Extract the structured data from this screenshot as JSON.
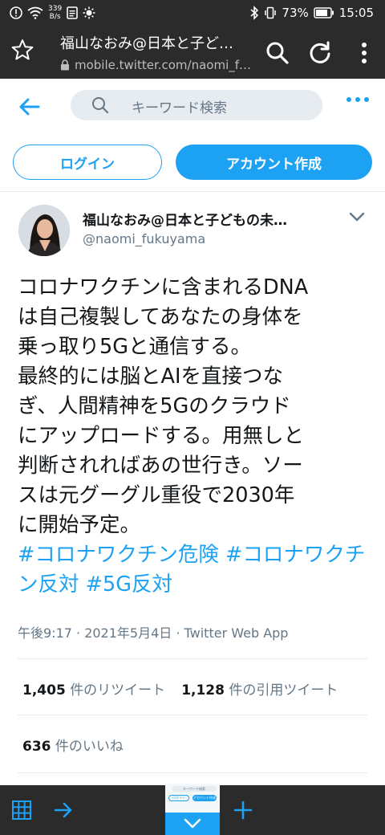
{
  "status_bar": {
    "net_speed_top": "339",
    "net_speed_bottom": "B/s",
    "battery": "73%",
    "time": "15:05"
  },
  "browser": {
    "title": "福山なおみ@日本と子ど…",
    "url": "mobile.twitter.com/naomi_f…"
  },
  "twitter": {
    "search_placeholder": "キーワード検索",
    "login_label": "ログイン",
    "signup_label": "アカウント作成"
  },
  "tweet": {
    "author_name": "福山なおみ@日本と子どもの未…",
    "author_handle": "@naomi_fukuyama",
    "text": "コロナワクチンに含まれるDNA\nは自己複製してあなたの身体を\n乗っ取り5Gと通信する。\n最終的には脳とAIを直接つな\nぎ、人間精神を5Gのクラウド\nにアップロードする。用無しと\n判断されればあの世行き。ソー\nスは元グーグル重役で2030年\nに開始予定。",
    "hashtags": "#コロナワクチン危険 #コロナワクチン反対 #5G反対",
    "meta": "午後9:17 · 2021年5月4日 · Twitter Web App",
    "retweets_count": "1,405",
    "retweets_label": "件のリツイート",
    "quotes_count": "1,128",
    "quotes_label": "件の引用ツイート",
    "likes_count": "636",
    "likes_label": "件のいいね"
  },
  "thumbnail": {
    "search": "キーワード検索",
    "login": "ログイン",
    "signup": "アカウント作成"
  },
  "colors": {
    "accent": "#1da1f2",
    "dark_bar": "#2b2b2b",
    "secondary_text": "#657786"
  }
}
